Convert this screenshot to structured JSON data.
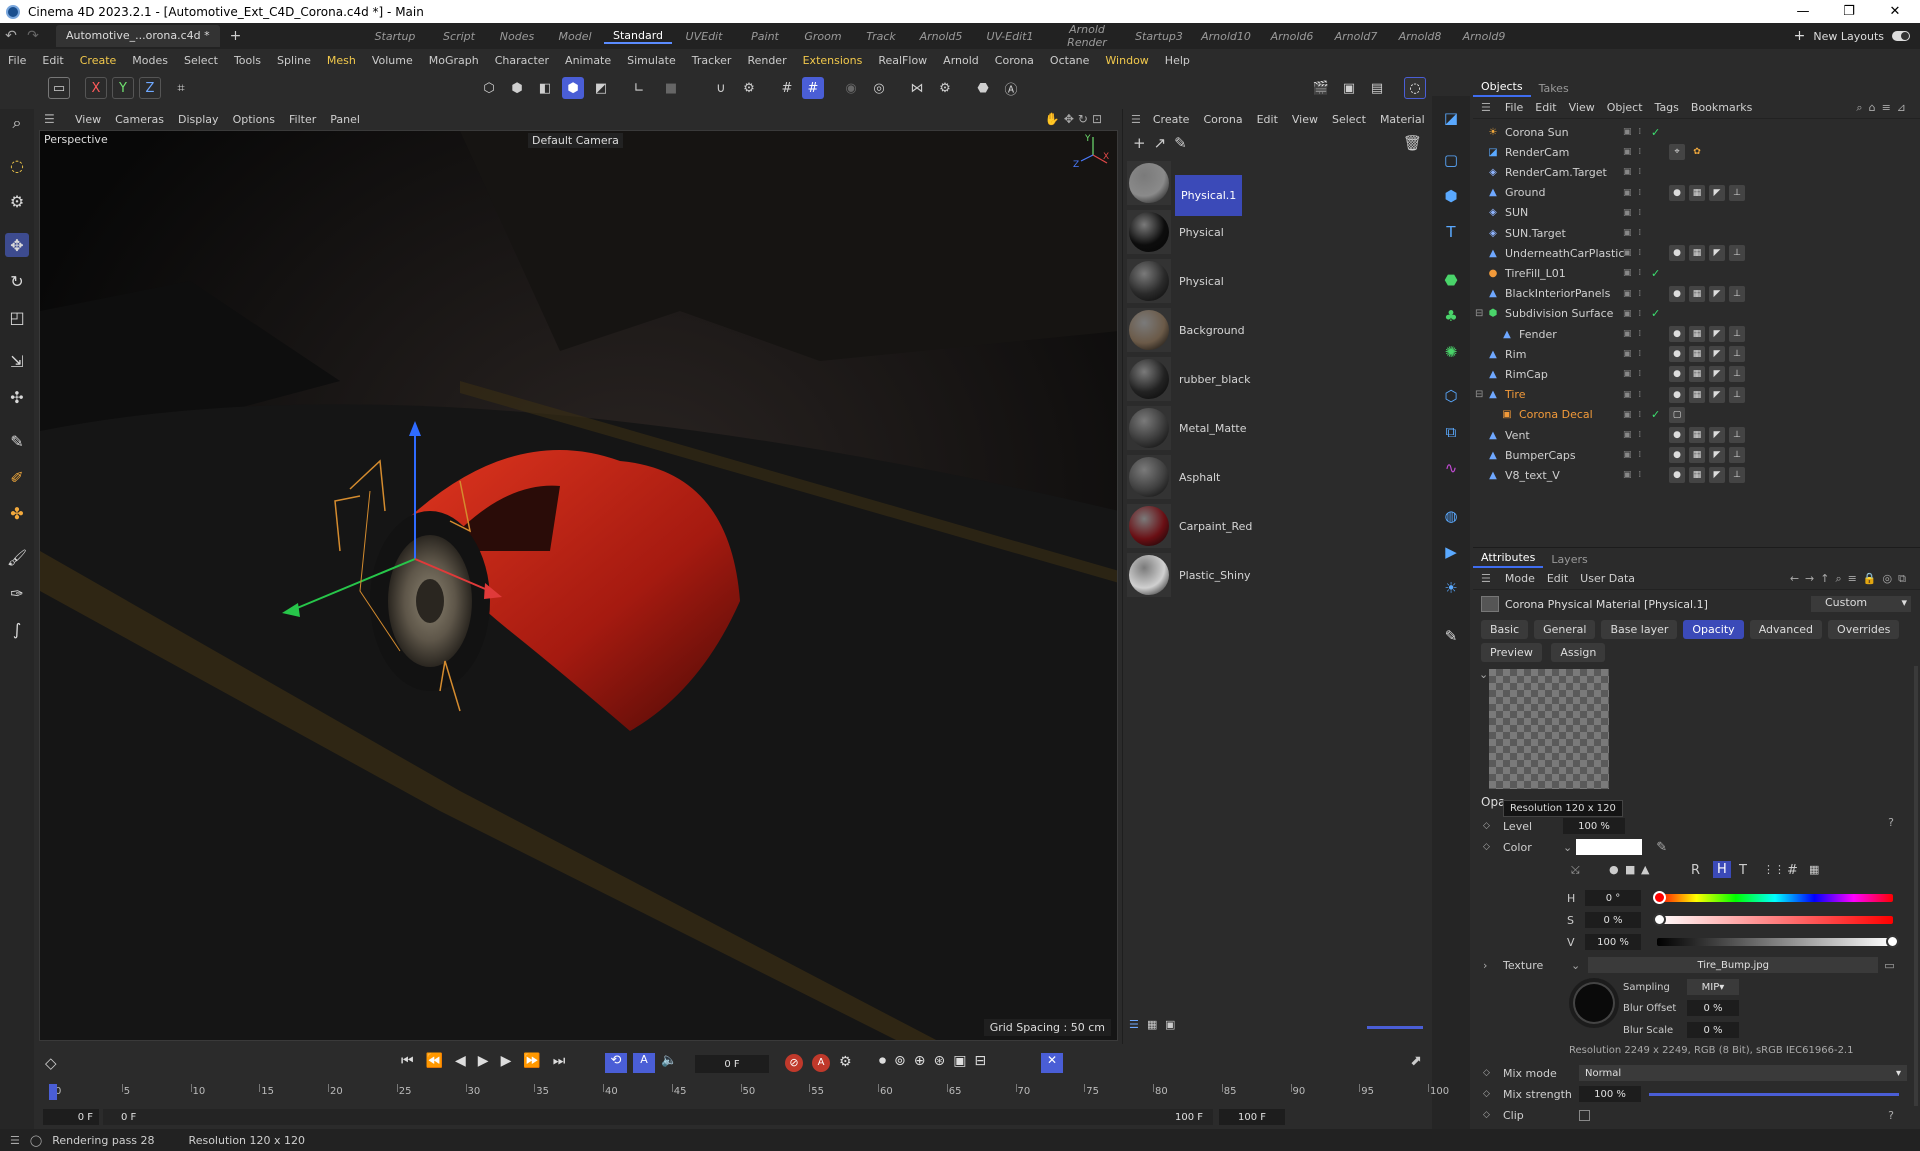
{
  "window": {
    "title": "Cinema 4D 2023.2.1 - [Automotive_Ext_C4D_Corona.c4d *] - Main",
    "controls": [
      "—",
      "❐",
      "✕"
    ]
  },
  "tabbar": {
    "file_tab": "Automotive_...orona.c4d *",
    "layouts": [
      "Startup",
      "Script",
      "Nodes",
      "Model",
      "Standard",
      "UVEdit",
      "Paint",
      "Groom",
      "Track",
      "Arnold5",
      "UV-Edit1",
      "Arnold Render",
      "Startup3",
      "Arnold10",
      "Arnold6",
      "Arnold7",
      "Arnold8",
      "Arnold9"
    ],
    "active_layout": "Standard",
    "new_layouts": "New Layouts"
  },
  "menubar": [
    "File",
    "Edit",
    "Create",
    "Modes",
    "Select",
    "Tools",
    "Spline",
    "Mesh",
    "Volume",
    "MoGraph",
    "Character",
    "Animate",
    "Simulate",
    "Tracker",
    "Render",
    "Extensions",
    "RealFlow",
    "Arnold",
    "Corona",
    "Octane",
    "Window",
    "Help"
  ],
  "toolbar": {
    "axes": [
      "X",
      "Y",
      "Z"
    ]
  },
  "viewport": {
    "menu": [
      "View",
      "Cameras",
      "Display",
      "Options",
      "Filter",
      "Panel"
    ],
    "label": "Perspective",
    "camera": "Default Camera",
    "grid_spacing": "Grid Spacing : 50 cm",
    "axis_labels": [
      "Y",
      "Z",
      "X"
    ]
  },
  "material_manager": {
    "menu": [
      "Create",
      "Corona",
      "Edit",
      "View",
      "Select",
      "Material"
    ],
    "materials": [
      {
        "name": "Physical.1",
        "selected": true,
        "color": "#8a8a8a"
      },
      {
        "name": "Physical",
        "selected": false,
        "color": "#0d0d0d"
      },
      {
        "name": "Physical",
        "selected": false,
        "color": "#2a2a2a"
      },
      {
        "name": "Background",
        "selected": false,
        "color": "#6b5a48"
      },
      {
        "name": "rubber_black",
        "selected": false,
        "color": "#222222"
      },
      {
        "name": "Metal_Matte",
        "selected": false,
        "color": "#3a3a3a"
      },
      {
        "name": "Asphalt",
        "selected": false,
        "color": "#404040"
      },
      {
        "name": "Carpaint_Red",
        "selected": false,
        "color": "#6a0f14"
      },
      {
        "name": "Plastic_Shiny",
        "selected": false,
        "color": "#d0d0d0"
      }
    ]
  },
  "objects_panel": {
    "tabs": [
      "Objects",
      "Takes"
    ],
    "menu": [
      "File",
      "Edit",
      "View",
      "Object",
      "Tags",
      "Bookmarks"
    ],
    "objects": [
      {
        "name": "Corona Sun",
        "icon": "sun-icon",
        "check": true,
        "indent": 0,
        "tags": []
      },
      {
        "name": "RenderCam",
        "icon": "camera-icon",
        "check": false,
        "indent": 0,
        "tags": [
          "target-tag",
          "corona-tag"
        ]
      },
      {
        "name": "RenderCam.Target",
        "icon": "null-icon",
        "check": false,
        "indent": 0,
        "tags": []
      },
      {
        "name": "Ground",
        "icon": "mesh-icon",
        "check": false,
        "indent": 0,
        "tags": [
          "material",
          "texture",
          "phong",
          "lock"
        ]
      },
      {
        "name": "SUN",
        "icon": "null-icon",
        "check": false,
        "indent": 0,
        "tags": []
      },
      {
        "name": "SUN.Target",
        "icon": "null-icon",
        "check": false,
        "indent": 0,
        "tags": []
      },
      {
        "name": "UnderneathCarPlastic",
        "icon": "mesh-icon",
        "check": false,
        "indent": 0,
        "tags": [
          "material",
          "texture",
          "phong",
          "lock"
        ]
      },
      {
        "name": "TireFill_L01",
        "icon": "light-icon",
        "check": true,
        "indent": 0,
        "tags": []
      },
      {
        "name": "BlackInteriorPanels",
        "icon": "mesh-icon",
        "check": false,
        "indent": 0,
        "tags": [
          "material",
          "texture",
          "phong",
          "lock"
        ]
      },
      {
        "name": "Subdivision Surface",
        "icon": "subdiv-icon",
        "check": true,
        "indent": 0,
        "tags": []
      },
      {
        "name": "Fender",
        "icon": "mesh-icon",
        "check": false,
        "indent": 1,
        "tags": [
          "material",
          "texture",
          "phong",
          "lock"
        ]
      },
      {
        "name": "Rim",
        "icon": "mesh-icon",
        "check": false,
        "indent": 0,
        "tags": [
          "material",
          "texture",
          "phong",
          "lock"
        ]
      },
      {
        "name": "RimCap",
        "icon": "mesh-icon",
        "check": false,
        "indent": 0,
        "tags": [
          "material",
          "texture",
          "phong",
          "lock"
        ]
      },
      {
        "name": "Tire",
        "icon": "mesh-icon",
        "check": false,
        "indent": 0,
        "orange": true,
        "tags": [
          "material",
          "texture",
          "phong",
          "lock"
        ]
      },
      {
        "name": "Corona Decal",
        "icon": "decal-icon",
        "check": true,
        "indent": 1,
        "orange": true,
        "tags": [
          "decal"
        ]
      },
      {
        "name": "Vent",
        "icon": "mesh-icon",
        "check": false,
        "indent": 0,
        "tags": [
          "material",
          "texture",
          "phong",
          "lock"
        ]
      },
      {
        "name": "BumperCaps",
        "icon": "mesh-icon",
        "check": false,
        "indent": 0,
        "tags": [
          "material",
          "texture",
          "phong",
          "lock"
        ]
      },
      {
        "name": "V8_text_V",
        "icon": "mesh-icon",
        "check": false,
        "indent": 0,
        "tags": [
          "material",
          "texture",
          "phong",
          "lock"
        ]
      }
    ]
  },
  "attributes": {
    "tabs": [
      "Attributes",
      "Layers"
    ],
    "menu": [
      "Mode",
      "Edit",
      "User Data"
    ],
    "material_title": "Corona Physical Material [Physical.1]",
    "preset": "Custom",
    "prop_tabs": [
      "Basic",
      "General",
      "Base layer",
      "Opacity",
      "Advanced",
      "Overrides"
    ],
    "active_tab": "Opacity",
    "sub_tabs": [
      "Preview",
      "Assign"
    ],
    "section_label": "Opa",
    "preview_tooltip": "Resolution 120 x 120",
    "level_label": "Level",
    "level_value": "100 %",
    "color_label": "Color",
    "color_modes": [
      "R",
      "H",
      "T"
    ],
    "active_color_mode": "H",
    "h_label": "H",
    "h_value": "0 °",
    "s_label": "S",
    "s_value": "0 %",
    "v_label": "V",
    "v_value": "100 %",
    "v_fraction": 1.0,
    "texture_label": "Texture",
    "texture_file": "Tire_Bump.jpg",
    "sampling_label": "Sampling",
    "sampling_value": "MIP",
    "blur_offset_label": "Blur Offset",
    "blur_offset_value": "0 %",
    "blur_scale_label": "Blur Scale",
    "blur_scale_value": "0 %",
    "texture_info": "Resolution 2249 x 2249, RGB (8 Bit), sRGB IEC61966-2.1",
    "mix_mode_label": "Mix mode",
    "mix_mode_value": "Normal",
    "mix_strength_label": "Mix strength",
    "mix_strength_value": "100 %",
    "mix_strength_fraction": 1.0,
    "clip_label": "Clip",
    "help_mark": "?"
  },
  "timeline": {
    "current_frame": "0 F",
    "start_field": "0 F",
    "start_field2": "0 F",
    "end_label": "100 F",
    "end_field": "100 F",
    "ticks": [
      "0",
      "5",
      "10",
      "15",
      "20",
      "25",
      "30",
      "35",
      "40",
      "45",
      "50",
      "55",
      "60",
      "65",
      "70",
      "75",
      "80",
      "85",
      "90",
      "95",
      "100"
    ]
  },
  "status": {
    "message": "Rendering pass 28",
    "info": "Resolution 120 x 120"
  }
}
